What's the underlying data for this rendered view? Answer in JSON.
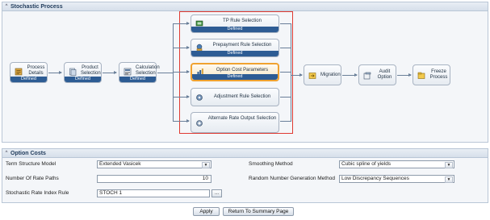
{
  "stochastic_process": {
    "title": "Stochastic Process",
    "toggle": "^",
    "nodes": {
      "process_details": {
        "label": "Process Details",
        "status": "Defined"
      },
      "product_selection": {
        "label": "Product Selection",
        "status": "Defined"
      },
      "calculation_selection": {
        "label": "Calculation Selection",
        "status": "Defined"
      },
      "tp_rule": {
        "label": "TP Rule Selection",
        "status": "Defined"
      },
      "prepayment_rule": {
        "label": "Prepayment Rule Selection",
        "status": "Defined"
      },
      "option_cost": {
        "label": "Option Cost Parameters",
        "status": "Defined"
      },
      "adjustment_rule": {
        "label": "Adjustment Rule Selection"
      },
      "alternate_rate": {
        "label": "Alternate Rate Output Selection"
      },
      "migration": {
        "label": "Migration"
      },
      "audit_option": {
        "label": "Audit Option"
      },
      "freeze_process": {
        "label": "Freeze Process"
      }
    }
  },
  "option_costs": {
    "title": "Option Costs",
    "toggle": "^",
    "term_structure_model": {
      "label": "Term Structure Model",
      "value": "Extended Vasicek"
    },
    "number_of_rate_paths": {
      "label": "Number Of Rate Paths",
      "value": "10"
    },
    "stochastic_rate_index_rule": {
      "label": "Stochastic Rate Index Rule",
      "value": "STOCH 1",
      "button": "..."
    },
    "smoothing_method": {
      "label": "Smoothing Method",
      "value": "Cubic spline of yields"
    },
    "random_number_generation_method": {
      "label": "Random Number Generation Method",
      "value": "Low Discrepancy Sequences"
    }
  },
  "buttons": {
    "apply": "Apply",
    "return_summary": "Return To Summary Page"
  },
  "colors": {
    "accent": "#2d5c94",
    "highlight_box": "#e03a32",
    "active_node": "#f0a230"
  },
  "icons": [
    "details-icon",
    "product-icon",
    "calculator-icon",
    "tp-rule-icon",
    "prepayment-icon",
    "option-cost-icon",
    "adjustment-icon",
    "alternate-rate-icon",
    "migration-icon",
    "audit-icon",
    "freeze-icon"
  ]
}
